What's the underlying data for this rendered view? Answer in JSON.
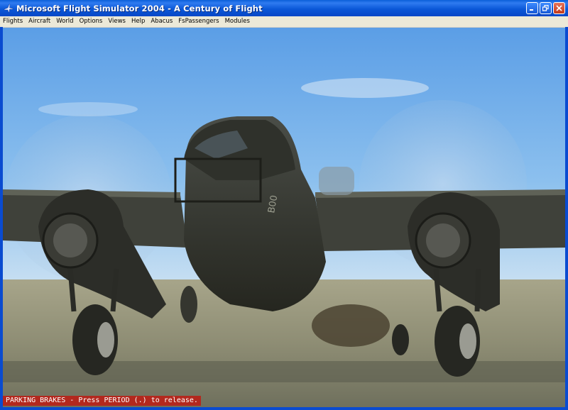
{
  "window": {
    "title": "Microsoft Flight Simulator 2004 - A Century of Flight",
    "icon": "airplane-icon",
    "controls": [
      "minimize-icon",
      "restore-icon",
      "close-icon"
    ]
  },
  "menu": {
    "items": [
      "Flights",
      "Aircraft",
      "World",
      "Options",
      "Views",
      "Help",
      "Abacus",
      "FsPassengers",
      "Modules"
    ]
  },
  "scene": {
    "aircraft_code": "B00"
  },
  "status": {
    "message": "PARKING BRAKES - Press PERIOD (.) to release.",
    "color": "#b3281e"
  }
}
